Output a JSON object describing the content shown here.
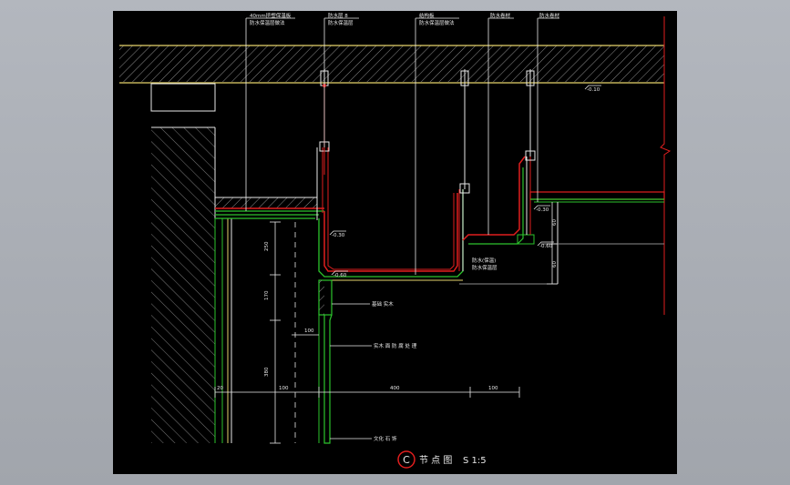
{
  "drawing": {
    "callouts": {
      "c1": "40mm挤塑保温板",
      "c2": "防水层 8",
      "c3": "结构板",
      "c4": "防水卷材",
      "c5": "防水卷材",
      "c1b": "防水保温层做法",
      "c2b": "防水保温层",
      "c3b": "防水保温层做法",
      "c4b": "",
      "c5b": ""
    },
    "labels": {
      "mid_callout_a": "防水(保温)",
      "mid_callout_b": "防水保温层",
      "l1": "基础 实木",
      "l2": "实木 面 防 腐 处 理",
      "l3": "文化 石 饰"
    },
    "levels": {
      "lv_top": "-0.10",
      "lv_left": "-0.30",
      "lv_bottom": "-0.60",
      "lv_right": "-0.30",
      "lv_right2": "-0.60"
    },
    "dims": {
      "v1": "250",
      "v2": "170",
      "v3": "380",
      "h1": "20",
      "h2": "100",
      "h3": "400",
      "h4": "100",
      "h5": "100",
      "r1": "60",
      "r2": "60"
    },
    "title": {
      "symbol": "C",
      "text": "节 点 图",
      "scale": "S 1:5"
    },
    "colors": {
      "background": "#000000",
      "structure": "#e5d36b",
      "insulation": "#2cc42c",
      "membrane": "#e01e1e",
      "leader": "#e8e8e8",
      "hatch": "#8c8c8c"
    }
  }
}
